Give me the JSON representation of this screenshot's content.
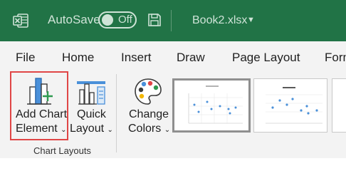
{
  "titlebar": {
    "autosave_label": "AutoSave",
    "toggle_state": "Off",
    "filename": "Book2.xlsx",
    "background": "#217346"
  },
  "menu": {
    "items": [
      "File",
      "Home",
      "Insert",
      "Draw",
      "Page Layout",
      "Form"
    ]
  },
  "ribbon": {
    "add_chart_line1": "Add Chart",
    "add_chart_line2": "Element",
    "quick_layout_line1": "Quick",
    "quick_layout_line2": "Layout",
    "change_colors_line1": "Change",
    "change_colors_line2": "Colors",
    "group_label": "Chart Layouts"
  },
  "colors": {
    "highlight": "#e04646",
    "accent": "#217346"
  },
  "icons": [
    "excel-icon",
    "save-icon",
    "add-chart-element-icon",
    "quick-layout-icon",
    "palette-icon"
  ]
}
